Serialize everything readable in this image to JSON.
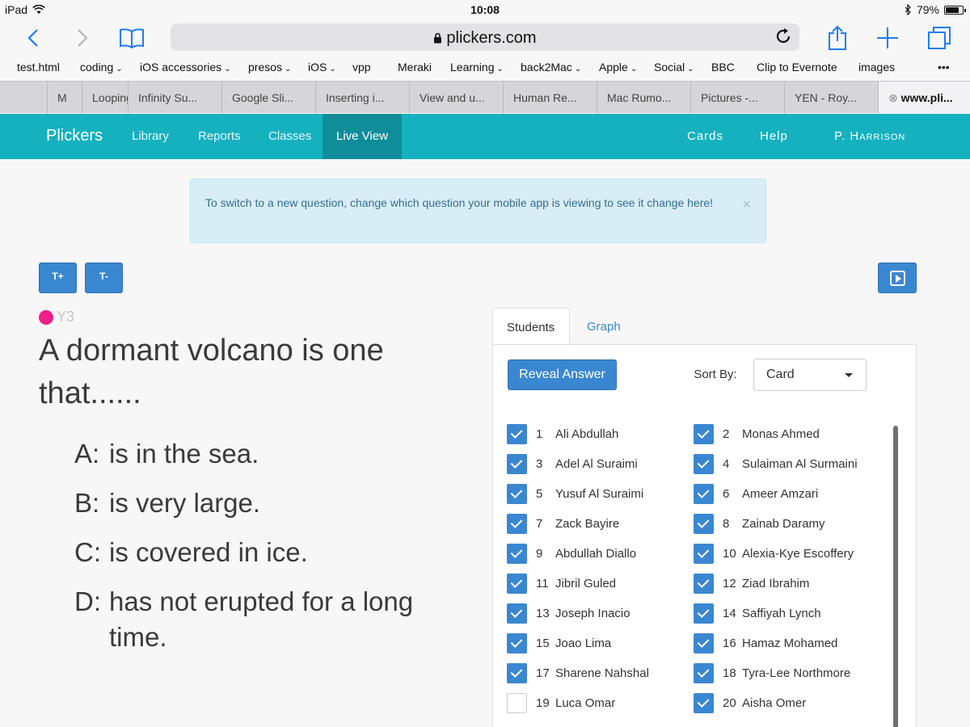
{
  "status": {
    "device": "iPad",
    "time": "10:08",
    "battery": "79%",
    "battery_level": 0.79
  },
  "browser": {
    "url": "plickers.com",
    "bookmarks": [
      {
        "label": "test.html",
        "menu": false
      },
      {
        "label": "coding",
        "menu": true
      },
      {
        "label": "iOS accessories",
        "menu": true
      },
      {
        "label": "presos",
        "menu": true
      },
      {
        "label": "iOS",
        "menu": true
      },
      {
        "label": "vpp",
        "menu": false
      },
      {
        "label": "Meraki",
        "menu": false
      },
      {
        "label": "Learning",
        "menu": true
      },
      {
        "label": "back2Mac",
        "menu": true
      },
      {
        "label": "Apple",
        "menu": true
      },
      {
        "label": "Social",
        "menu": true
      },
      {
        "label": "BBC",
        "menu": false
      },
      {
        "label": "Clip to Evernote",
        "menu": false
      },
      {
        "label": "images",
        "menu": false
      }
    ],
    "more": "•••",
    "tabs": [
      "M",
      "Looping",
      "Infinity Su...",
      "Google Sli...",
      "Inserting i...",
      "View and u...",
      "Human Re...",
      "Mac Rumo...",
      "Pictures -...",
      "YEN - Roy...",
      "www.pli..."
    ]
  },
  "nav": {
    "brand": "Plickers",
    "links": [
      "Library",
      "Reports",
      "Classes"
    ],
    "active": "Live View",
    "right": [
      "Cards",
      "Help",
      "P. Harrison"
    ]
  },
  "alert": {
    "text": "To switch to a new question, change which question your mobile app is viewing to see it change here!",
    "close": "×"
  },
  "controls": {
    "text_bigger": "T+",
    "text_smaller": "T-"
  },
  "question": {
    "class_label": "Y3",
    "class_color": "#ec1f8b",
    "text": "A dormant volcano is one that......",
    "answers": [
      {
        "key": "A:",
        "text": "is in the sea."
      },
      {
        "key": "B:",
        "text": "is very large."
      },
      {
        "key": "C:",
        "text": "is covered in ice."
      },
      {
        "key": "D:",
        "text": "has not erupted for a long time."
      }
    ]
  },
  "panel": {
    "tabs": [
      "Students",
      "Graph"
    ],
    "reveal": "Reveal Answer",
    "sort_label": "Sort By:",
    "sort_value": "Card",
    "students": [
      {
        "n": "1",
        "name": "Ali Abdullah",
        "checked": true
      },
      {
        "n": "2",
        "name": "Monas Ahmed",
        "checked": true
      },
      {
        "n": "3",
        "name": "Adel Al Suraimi",
        "checked": true
      },
      {
        "n": "4",
        "name": "Sulaiman Al Surmaini",
        "checked": true
      },
      {
        "n": "5",
        "name": "Yusuf Al Suraimi",
        "checked": true
      },
      {
        "n": "6",
        "name": "Ameer Amzari",
        "checked": true
      },
      {
        "n": "7",
        "name": "Zack Bayire",
        "checked": true
      },
      {
        "n": "8",
        "name": "Zainab Daramy",
        "checked": true
      },
      {
        "n": "9",
        "name": "Abdullah Diallo",
        "checked": true
      },
      {
        "n": "10",
        "name": "Alexia-Kye Escoffery",
        "checked": true
      },
      {
        "n": "11",
        "name": "Jibril Guled",
        "checked": true
      },
      {
        "n": "12",
        "name": "Ziad Ibrahim",
        "checked": true
      },
      {
        "n": "13",
        "name": "Joseph Inacio",
        "checked": true
      },
      {
        "n": "14",
        "name": "Saffiyah Lynch",
        "checked": true
      },
      {
        "n": "15",
        "name": "Joao Lima",
        "checked": true
      },
      {
        "n": "16",
        "name": "Hamaz Mohamed",
        "checked": true
      },
      {
        "n": "17",
        "name": "Sharene Nahshal",
        "checked": true
      },
      {
        "n": "18",
        "name": "Tyra-Lee Northmore",
        "checked": true
      },
      {
        "n": "19",
        "name": "Luca Omar",
        "checked": false
      },
      {
        "n": "20",
        "name": "Aisha Omer",
        "checked": true
      }
    ]
  }
}
